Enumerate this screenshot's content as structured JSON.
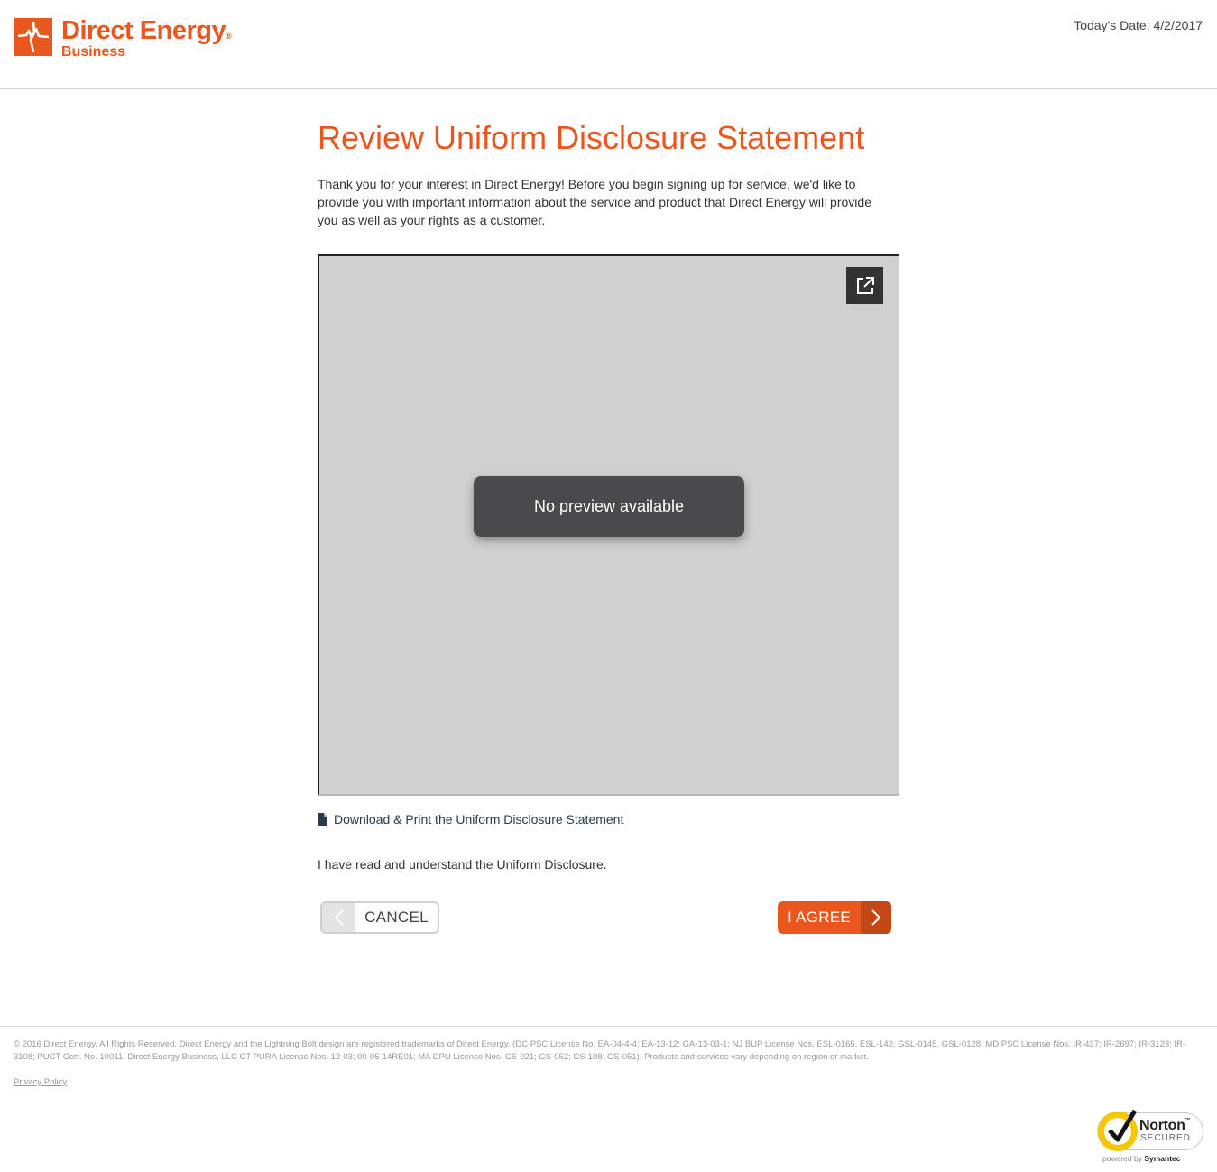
{
  "header": {
    "brand_name": "Direct Energy",
    "brand_sub": "Business",
    "date_label": "Today's Date: 4/2/2017"
  },
  "main": {
    "title": "Review Uniform Disclosure Statement",
    "intro": "Thank you for your interest in Direct Energy! Before you begin signing up for service, we'd like to provide you with important information about the service and product that Direct Energy will provide you as well as your rights as a customer.",
    "preview_message": "No preview available",
    "download_link": "Download & Print the Uniform Disclosure Statement",
    "acknowledgement": "I have read and understand the Uniform Disclosure.",
    "cancel_label": "CANCEL",
    "agree_label": "I AGREE"
  },
  "footer": {
    "legal": "© 2016 Direct Energy. All Rights Reserved. Direct Energy and the Lightning Bolt design are registered trademarks of Direct Energy. (DC PSC License No. EA-04-4-4; EA-13-12; GA-13-03-1; NJ BUP License Nos. ESL-0165, ESL-142, GSL-0145, GSL-0128; MD PSC License Nos. IR-437; IR-2697; IR-3123; IR-3108; PUCT Cert. No. 10011; Direct Energy Business, LLC CT PURA License Nos. 12-03; 00-05-14RE01; MA DPU License Nos. CS-021; GS-052; CS-108; GS-051). Products and services vary depending on region or market.",
    "privacy": "Privacy Policy"
  },
  "norton": {
    "brand": "Norton",
    "secured": "SECURED",
    "powered_by": "powered by",
    "symantec": "Symantec"
  },
  "colors": {
    "accent": "#e9571f",
    "accent_dark": "#c44716",
    "preview_bg": "#d0d0d0",
    "toast_bg": "#4a4a4c"
  },
  "icons": [
    "lightning-logo-icon",
    "external-link-icon",
    "document-icon",
    "chevron-left-icon",
    "chevron-right-icon",
    "checkmark-icon"
  ]
}
